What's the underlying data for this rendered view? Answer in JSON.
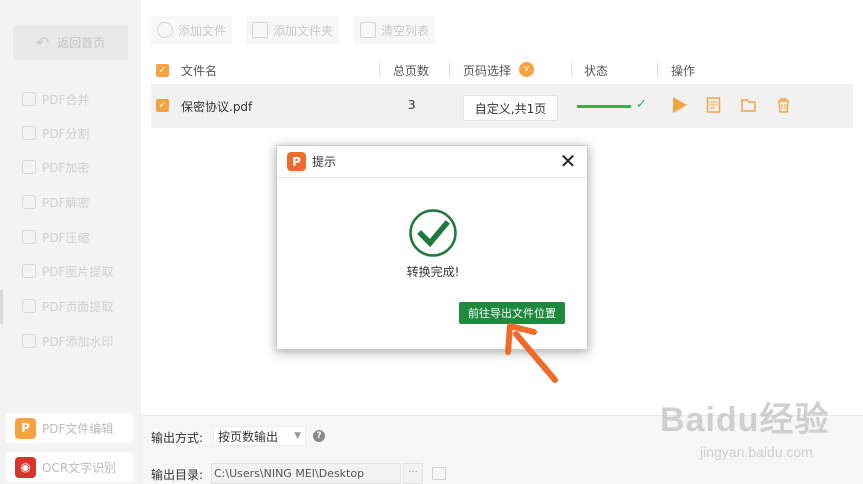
{
  "sidebar": {
    "back_label": "返回首页",
    "items": [
      {
        "label": "PDF合并",
        "icon": "merge-icon"
      },
      {
        "label": "PDF分割",
        "icon": "split-icon"
      },
      {
        "label": "PDF加密",
        "icon": "lock-shield-icon"
      },
      {
        "label": "PDF解密",
        "icon": "unlock-shield-icon"
      },
      {
        "label": "PDF压缩",
        "icon": "compress-icon"
      },
      {
        "label": "PDF图片提取",
        "icon": "image-extract-icon"
      },
      {
        "label": "PDF页面提取",
        "icon": "page-extract-icon"
      },
      {
        "label": "PDF添加水印",
        "icon": "watermark-icon"
      }
    ],
    "bottom_buttons": [
      {
        "label": "PDF文件编辑",
        "icon_text": "P",
        "color": "#f5a340"
      },
      {
        "label": "OCR文字识别",
        "icon_text": "◉",
        "color": "#d9342b"
      }
    ]
  },
  "toolbar": {
    "add_file": "添加文件",
    "add_folder": "添加文件夹",
    "clear_list": "清空列表"
  },
  "table": {
    "headers": {
      "filename": "文件名",
      "pages": "总页数",
      "page_select": "页码选择",
      "status": "状态",
      "actions": "操作"
    },
    "rows": [
      {
        "filename": "保密协议.pdf",
        "pages": "3",
        "page_select": "自定义,共1页",
        "checked": true,
        "progress": 1.0
      }
    ]
  },
  "dialog": {
    "title": "提示",
    "logo_text": "P",
    "message": "转换完成!",
    "button": "前往导出文件位置"
  },
  "bottom": {
    "output_mode_label": "输出方式:",
    "output_mode_value": "按页数输出",
    "output_dir_label": "输出目录:",
    "output_dir_value": "C:\\Users\\NING MEI\\Desktop",
    "browse_label": "···"
  },
  "watermark": {
    "logo": "Baidu经验",
    "sub": "jingyan.baidu.com"
  },
  "colors": {
    "accent_orange": "#f5a340",
    "success_green": "#1e8a3e",
    "arrow_orange": "#f06a2a"
  }
}
